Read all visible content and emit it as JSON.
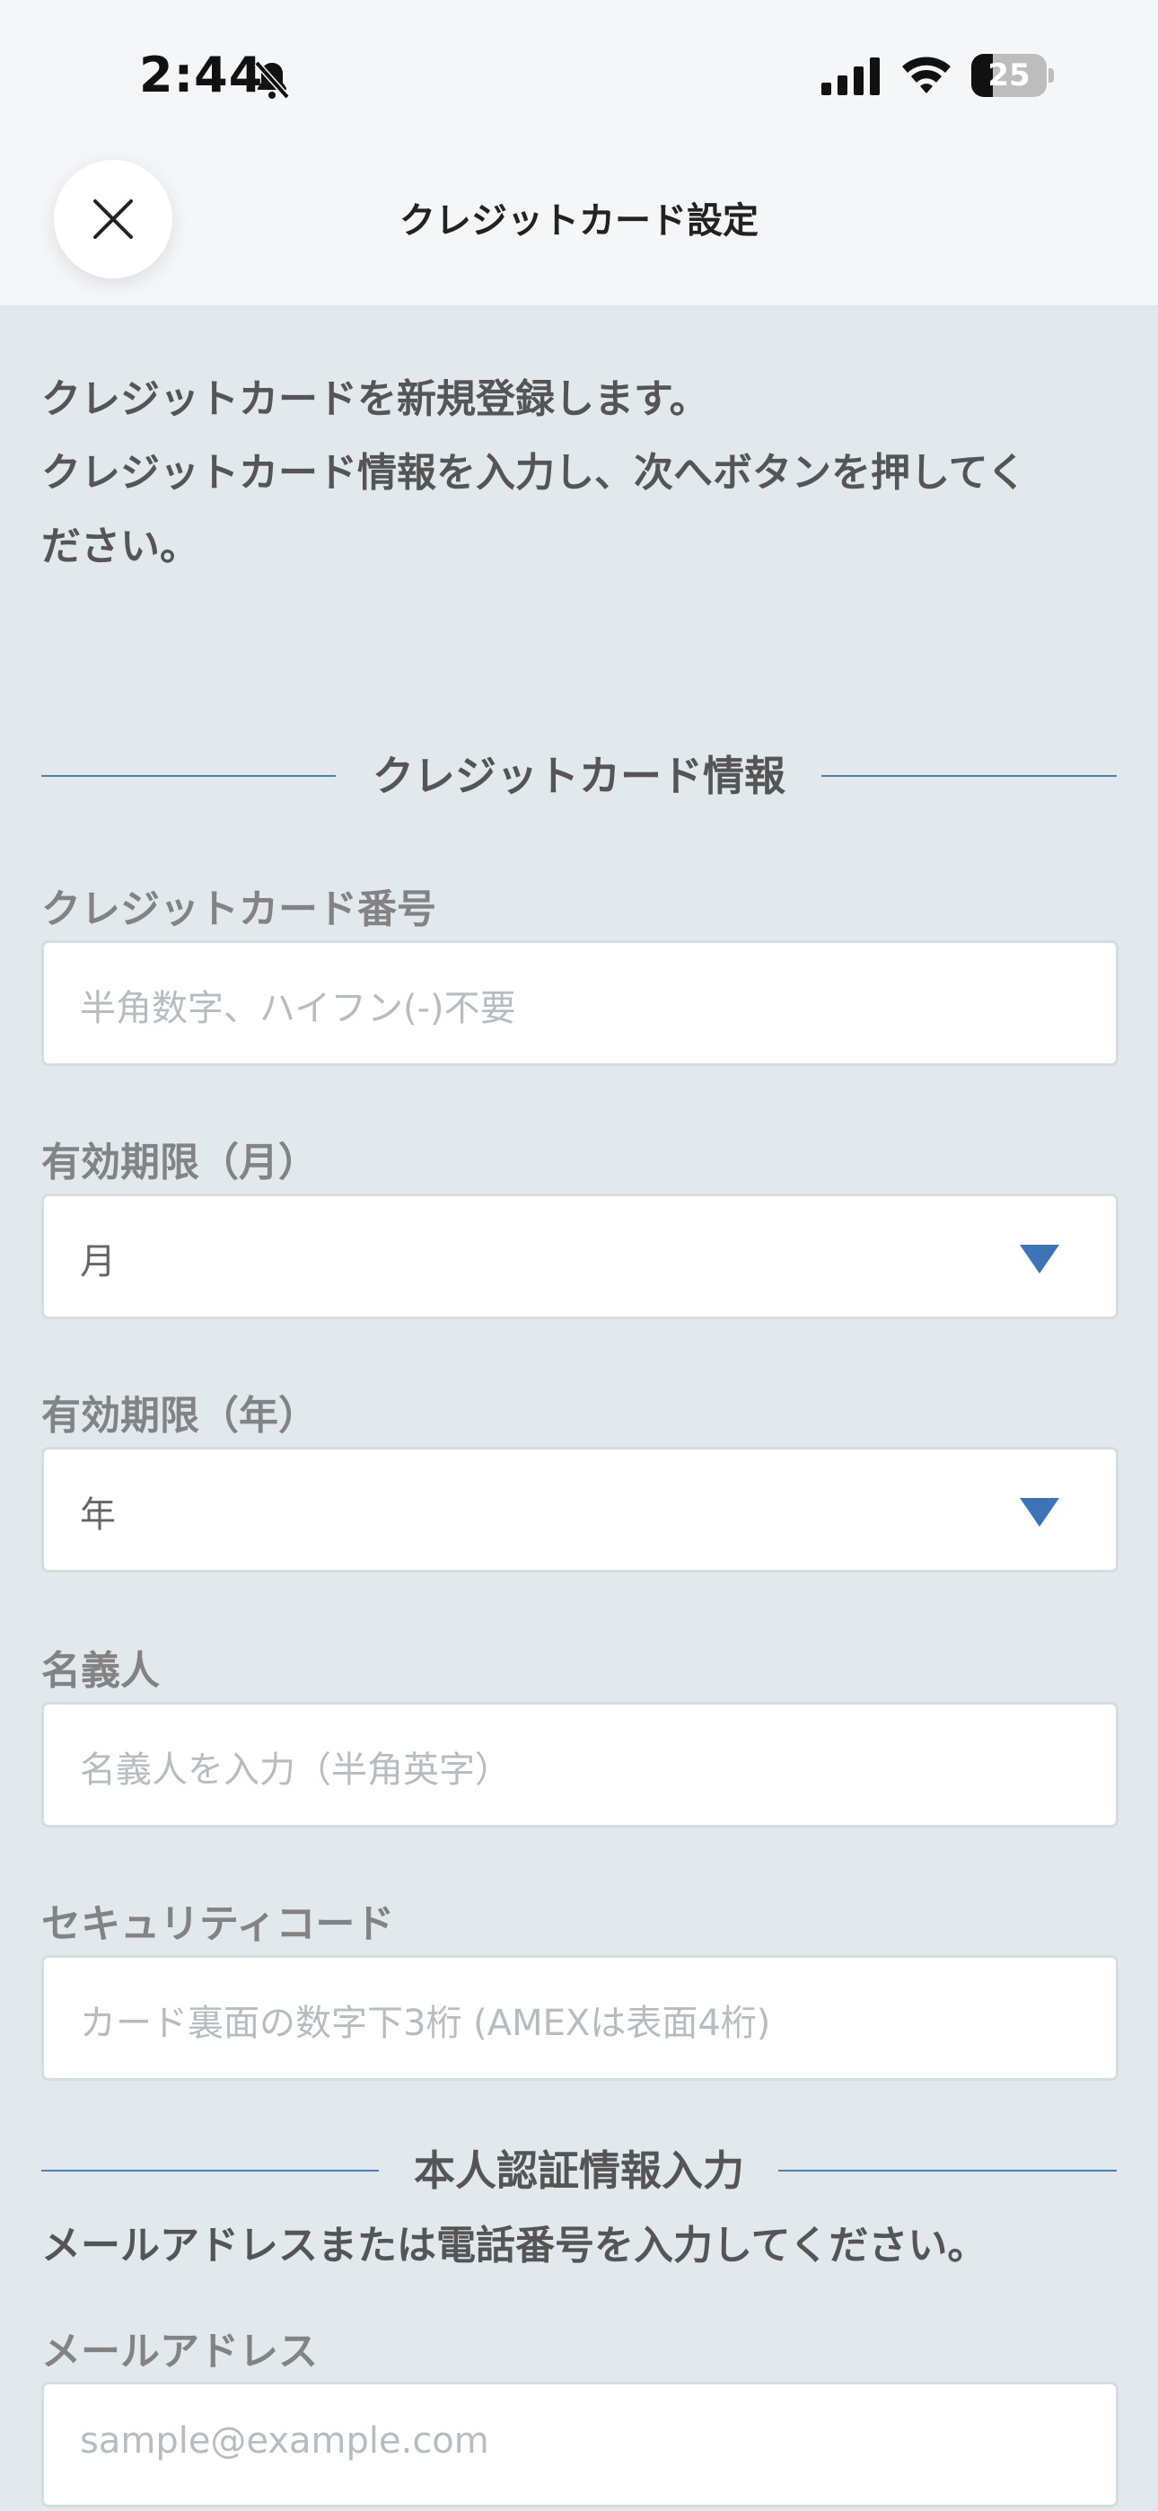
{
  "status_bar": {
    "time": "2:44",
    "battery_percent": "25",
    "icons": [
      "bell-slash-icon",
      "cellular-signal-icon",
      "wifi-icon",
      "battery-icon"
    ]
  },
  "header": {
    "title": "クレジットカード設定",
    "close_icon": "close-icon"
  },
  "intro": {
    "line1": "クレジットカードを新規登録します。",
    "line2": "クレジットカード情報を入力し、次へボタンを押してく",
    "line3": "ださい。"
  },
  "card_section": {
    "title": "クレジットカード情報",
    "number_label": "クレジットカード番号",
    "number_placeholder": "半角数字、ハイフン(-)不要",
    "month_label": "有効期限（月）",
    "month_value": "月",
    "year_label": "有効期限（年）",
    "year_value": "年",
    "holder_label": "名義人",
    "holder_placeholder": "名義人を入力（半角英字）",
    "cvc_label": "セキュリティコード",
    "cvc_placeholder": "カード裏面の数字下3桁 (AMEXは表面4桁)"
  },
  "auth_section": {
    "title": "本人認証情報入力",
    "note": "メールアドレスまたは電話番号を入力してください。",
    "email_label": "メールアドレス",
    "email_placeholder": "sample@example.com"
  },
  "colors": {
    "background": "#e2e9ed",
    "header_bg": "#f5f6f8",
    "accent_blue": "#3d74b8",
    "label_gray": "#838383",
    "text_dark": "#555555",
    "placeholder": "#b5bcc2"
  }
}
